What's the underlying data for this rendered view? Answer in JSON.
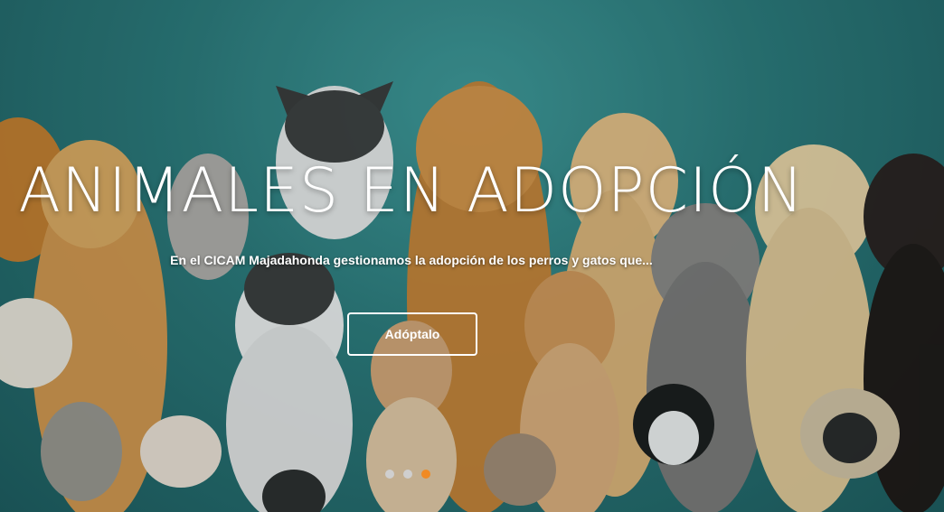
{
  "hero": {
    "title": "ANIMALES EN ADOPCIÓN",
    "subtitle": "En el CICAM Majadahonda gestionamos la adopción de los perros y gatos que...",
    "cta_label": "Adóptalo",
    "image_description_icon": "dogs-and-cats-photo",
    "colors": {
      "background": "#2b7a7b",
      "text": "#ffffff",
      "active_dot": "#f08a24",
      "inactive_dot": "#cfcfcf"
    }
  },
  "carousel": {
    "slide_count": 3,
    "active_index": 2
  }
}
